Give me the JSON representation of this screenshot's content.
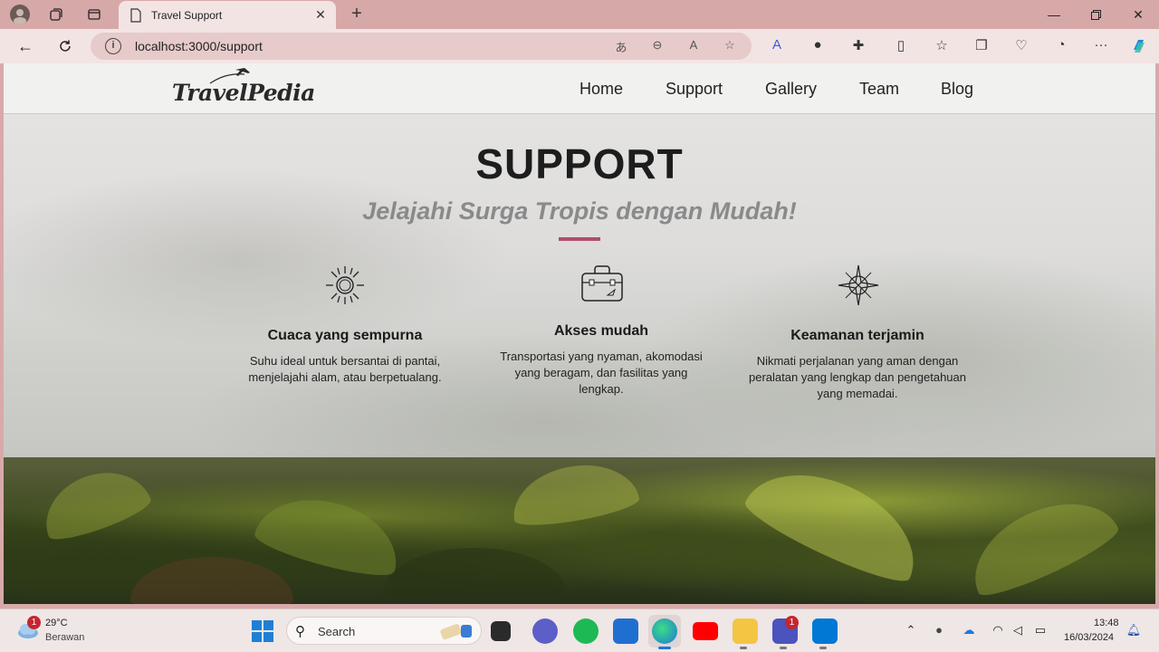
{
  "browser": {
    "tab_title": "Travel Support",
    "url": "localhost:3000/support"
  },
  "site": {
    "logo_text": "TravelPedia",
    "nav": [
      "Home",
      "Support",
      "Gallery",
      "Team",
      "Blog"
    ]
  },
  "hero": {
    "title": "SUPPORT",
    "subtitle": "Jelajahi Surga Tropis dengan Mudah!",
    "accent_color": "#b04f66"
  },
  "features": [
    {
      "icon": "sun-icon",
      "title": "Cuaca yang sempurna",
      "text": "Suhu ideal untuk bersantai di pantai, menjelajahi alam, atau berpetualang."
    },
    {
      "icon": "suitcase-icon",
      "title": "Akses mudah",
      "text": "Transportasi yang nyaman, akomodasi yang beragam, dan fasilitas yang lengkap."
    },
    {
      "icon": "compass-icon",
      "title": "Keamanan terjamin",
      "text": "Nikmati perjalanan yang aman dengan peralatan yang lengkap dan pengetahuan yang memadai."
    }
  ],
  "taskbar": {
    "weather_temp": "29°C",
    "weather_cond": "Berawan",
    "weather_badge": "1",
    "search_placeholder": "Search",
    "teams_badge": "1",
    "time": "13:48",
    "date": "16/03/2024"
  }
}
